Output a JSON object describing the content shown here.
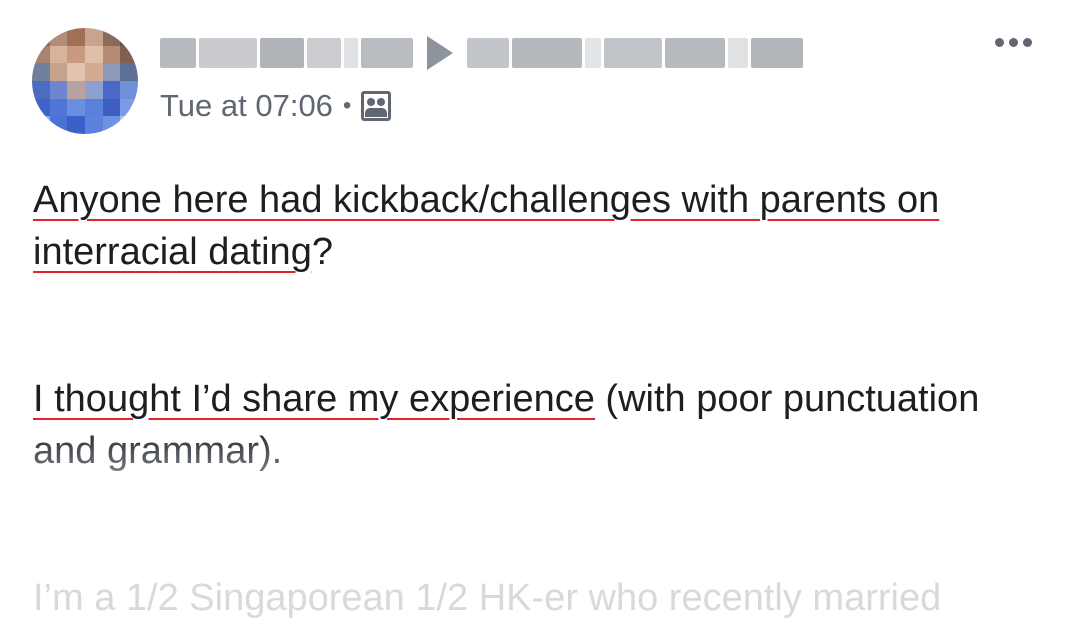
{
  "post": {
    "meta": {
      "timestamp": "Tue at 07:06",
      "separator": "•",
      "audience_icon": "group-icon"
    },
    "more_icon": "more-options-icon",
    "paragraphs": {
      "p1_underlined": "Anyone here had kickback/challenges with parents on interracial dating",
      "p1_tail": "?",
      "p2_underlined": "I thought I’d share my experience",
      "p2_tail": " (with poor punctuation and grammar).",
      "p3": "I’m a 1/2 Singaporean 1/2 HK-er who recently married"
    }
  },
  "colors": {
    "text": "#1c1e21",
    "meta": "#606770",
    "underline": "#e0242d"
  }
}
